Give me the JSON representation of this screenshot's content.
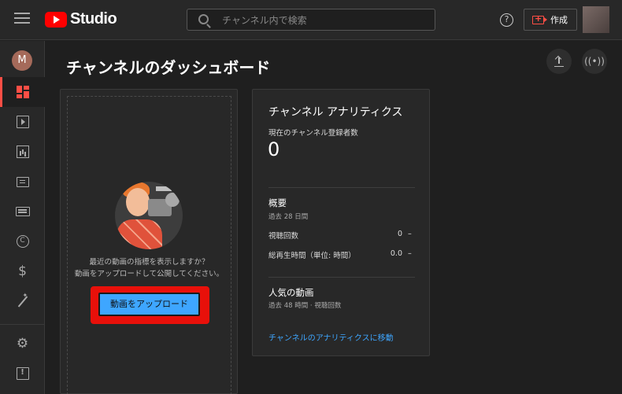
{
  "header": {
    "studio_label": "Studio",
    "search_placeholder": "チャンネル内で検索",
    "help_label": "?",
    "create_label": "作成"
  },
  "sidebar": {
    "avatar_letter": "M",
    "items": [
      {
        "name": "dashboard",
        "icon": "dashboard-icon",
        "active": true
      },
      {
        "name": "content",
        "icon": "video-icon"
      },
      {
        "name": "analytics",
        "icon": "analytics-icon"
      },
      {
        "name": "comments",
        "icon": "comment-icon"
      },
      {
        "name": "subtitles",
        "icon": "subtitles-icon"
      },
      {
        "name": "copyright",
        "icon": "copyright-icon"
      },
      {
        "name": "earn",
        "icon": "dollar-icon"
      },
      {
        "name": "customize",
        "icon": "magic-wand-icon"
      },
      {
        "name": "settings",
        "icon": "gear-icon"
      },
      {
        "name": "feedback",
        "icon": "feedback-icon"
      }
    ]
  },
  "main": {
    "page_title": "チャンネルのダッシュボード"
  },
  "upload_card": {
    "text_line1": "最近の動画の指標を表示しますか？",
    "text_line2": "動画をアップロードして公開してください。",
    "button_label": "動画をアップロード"
  },
  "analytics_card": {
    "title": "チャンネル アナリティクス",
    "subscribers_label": "現在のチャンネル登録者数",
    "subscribers_count": "0",
    "summary_title": "概要",
    "summary_period": "過去 28 日間",
    "views_label": "視聴回数",
    "views_value": "0",
    "views_delta": "–",
    "watch_label": "総再生時間（単位: 時間）",
    "watch_value": "0.0",
    "watch_delta": "–",
    "top_title": "人気の動画",
    "top_sub": "過去 48 時間 · 視聴回数",
    "link_label": "チャンネルのアナリティクスに移動"
  },
  "colors": {
    "accent_red": "#ff4e45",
    "link_blue": "#3ea6ff",
    "background": "#1f1f1f",
    "surface": "#282828"
  }
}
